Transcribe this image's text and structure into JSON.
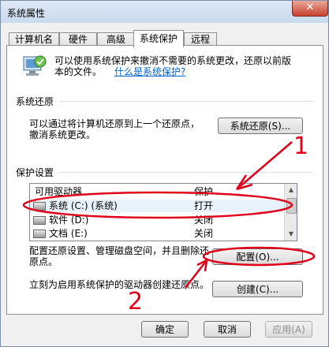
{
  "window": {
    "title": "系统属性",
    "close_label": "✕"
  },
  "tabs": [
    {
      "label": "计算机名"
    },
    {
      "label": "硬件"
    },
    {
      "label": "高级"
    },
    {
      "label": "系统保护"
    },
    {
      "label": "远程"
    }
  ],
  "intro": {
    "text_line1": "可以使用系统保护来撤消不需要的系统更改，还原以前版",
    "text_line2": "本的文件。",
    "link": "什么是系统保护?"
  },
  "restore": {
    "title": "系统还原",
    "text_line1": "可以通过将计算机还原到上一个还原点，",
    "text_line2": "撤消系统更改。",
    "button": "系统还原(S)..."
  },
  "protection": {
    "title": "保护设置",
    "columns": {
      "drive": "可用驱动器",
      "protection": "保护"
    },
    "rows": [
      {
        "drive": "系统 (C:) (系统)",
        "protection": "打开"
      },
      {
        "drive": "软件 (D:)",
        "protection": "关闭"
      },
      {
        "drive": "文档 (E:)",
        "protection": "关闭"
      }
    ]
  },
  "configure": {
    "text_line1": "配置还原设置、管理磁盘空间，并且删除还",
    "text_line2": "原点。",
    "button": "配置(O)..."
  },
  "create": {
    "text": "立刻为启用系统保护的驱动器创建还原点。",
    "button": "创建(C)..."
  },
  "footer": {
    "ok": "确定",
    "cancel": "取消",
    "apply": "应用(A)"
  },
  "annotations": {
    "label_1": "1",
    "label_2": "2",
    "color": "#e0001a"
  }
}
